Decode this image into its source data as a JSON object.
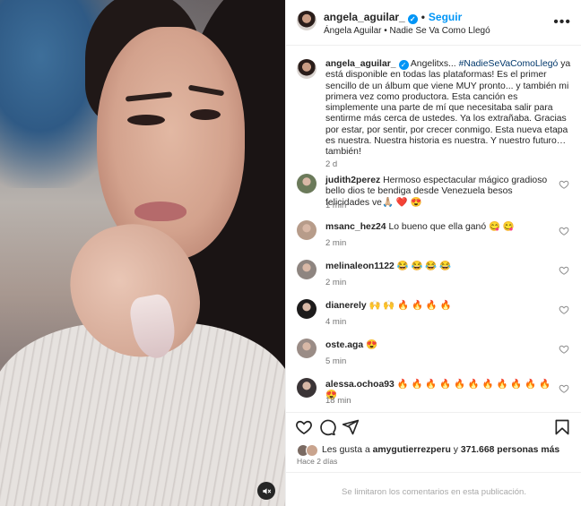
{
  "header": {
    "username": "angela_aguilar_",
    "follow_label": "Seguir",
    "song": "Ángela Aguilar • Nadie Se Va Como Llegó",
    "more_icon": "more-horizontal-icon"
  },
  "caption": {
    "username": "angela_aguilar_",
    "verified_icon": "verified-badge-icon",
    "text_before": "Angelitxs... ",
    "hashtag": "#NadieSeVaComoLlegó",
    "text_after": " ya está disponible en todas las plataformas! Es el primer sencillo de un álbum que viene MUY pronto... y también mi primera vez como productora. Esta canción es simplemente una parte de mí que necesitaba salir para sentirme más cerca de ustedes. Ya los extrañaba. Gracias por estar, por sentir, por crecer conmigo. Esta nueva etapa es nuestra. Nuestra historia es nuestra. Y nuestro futuro… también!",
    "time": "2 d"
  },
  "comments": [
    {
      "user": "judith2perez",
      "text": "Hermoso espectacular mágico gradioso bello dios te bendiga desde Venezuela besos felicidades ve🙏🏼 ❤️ 😍",
      "time": "1 min",
      "avatar_color": "#6b7a5a"
    },
    {
      "user": "msanc_hez24",
      "text": "Lo bueno que ella ganó 😋 😋",
      "time": "2 min",
      "avatar_color": "#b79c8a"
    },
    {
      "user": "melinaleon1122",
      "text": "😂 😂 😂 😂",
      "time": "2 min",
      "avatar_color": "#8e8580"
    },
    {
      "user": "dianerely",
      "text": "🙌 🙌 🔥 🔥 🔥 🔥",
      "time": "4 min",
      "avatar_color": "#1d1b1b"
    },
    {
      "user": "oste.aga",
      "text": "😍",
      "time": "5 min",
      "avatar_color": "#9a8c86"
    },
    {
      "user": "alessa.ochoa93",
      "text": "🔥 🔥 🔥 🔥 🔥 🔥 🔥 🔥 🔥 🔥 🔥 😍",
      "time": "18 min",
      "avatar_color": "#3a3436"
    }
  ],
  "actions": {
    "like_icon": "heart-icon",
    "comment_icon": "comment-icon",
    "share_icon": "share-icon",
    "save_icon": "bookmark-icon"
  },
  "likes": {
    "prefix": "Les gusta a ",
    "user": "amygutierrezperu",
    "middle": " y ",
    "count": "371.668 personas más"
  },
  "post_date": "Hace 2 días",
  "footer_message": "Se limitaron los comentarios en esta publicación.",
  "media": {
    "mute_icon": "audio-muted-icon"
  }
}
